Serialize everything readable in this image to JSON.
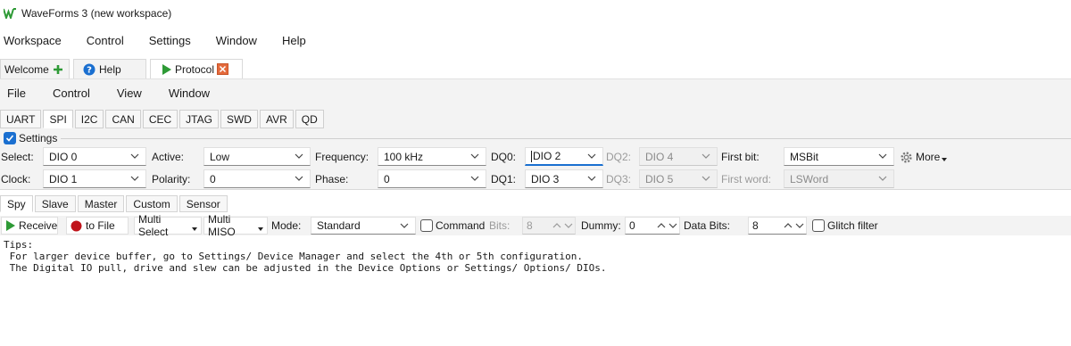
{
  "window": {
    "title": "WaveForms 3 (new workspace)"
  },
  "main_menu": [
    "Workspace",
    "Control",
    "Settings",
    "Window",
    "Help"
  ],
  "workspace_tabs": {
    "welcome": "Welcome",
    "help": "Help",
    "protocol": "Protocol"
  },
  "protocol_menu": [
    "File",
    "Control",
    "View",
    "Window"
  ],
  "protocol_tabs": [
    "UART",
    "SPI",
    "I2C",
    "CAN",
    "CEC",
    "JTAG",
    "SWD",
    "AVR",
    "QD"
  ],
  "settings": {
    "label": "Settings",
    "select_label": "Select:",
    "select_value": "DIO 0",
    "clock_label": "Clock:",
    "clock_value": "DIO 1",
    "active_label": "Active:",
    "active_value": "Low",
    "polarity_label": "Polarity:",
    "polarity_value": "0",
    "frequency_label": "Frequency:",
    "frequency_value": "100 kHz",
    "phase_label": "Phase:",
    "phase_value": "0",
    "dq0_label": "DQ0:",
    "dq0_value": "DIO 2",
    "dq1_label": "DQ1:",
    "dq1_value": "DIO 3",
    "dq2_label": "DQ2:",
    "dq2_value": "DIO 4",
    "dq3_label": "DQ3:",
    "dq3_value": "DIO 5",
    "first_bit_label": "First bit:",
    "first_bit_value": "MSBit",
    "first_word_label": "First word:",
    "first_word_value": "LSWord",
    "more_label": "More"
  },
  "mode_tabs": [
    "Spy",
    "Slave",
    "Master",
    "Custom",
    "Sensor"
  ],
  "spy_toolbar": {
    "receive": "Receive",
    "to_file": "to File",
    "multi_select": "Multi Select",
    "multi_miso": "Multi MISO",
    "mode_label": "Mode:",
    "mode_value": "Standard",
    "command_label": "Command",
    "bits_label": "Bits:",
    "bits_value": "8",
    "dummy_label": "Dummy:",
    "dummy_value": "0",
    "data_bits_label": "Data Bits:",
    "data_bits_value": "8",
    "glitch_label": "Glitch filter"
  },
  "console": {
    "line1": "Tips:",
    "line2": " For larger device buffer, go to Settings/ Device Manager and select the 4th or 5th configuration.",
    "line3": " The Digital IO pull, drive and slew can be adjusted in the Device Options or Settings/ Options/ DIOs."
  },
  "colors": {
    "accent": "#1a6fd0",
    "play_green": "#2e9a36",
    "record_red": "#c0141b",
    "close_orange": "#e46a3c",
    "band": "#f3f3f3"
  }
}
